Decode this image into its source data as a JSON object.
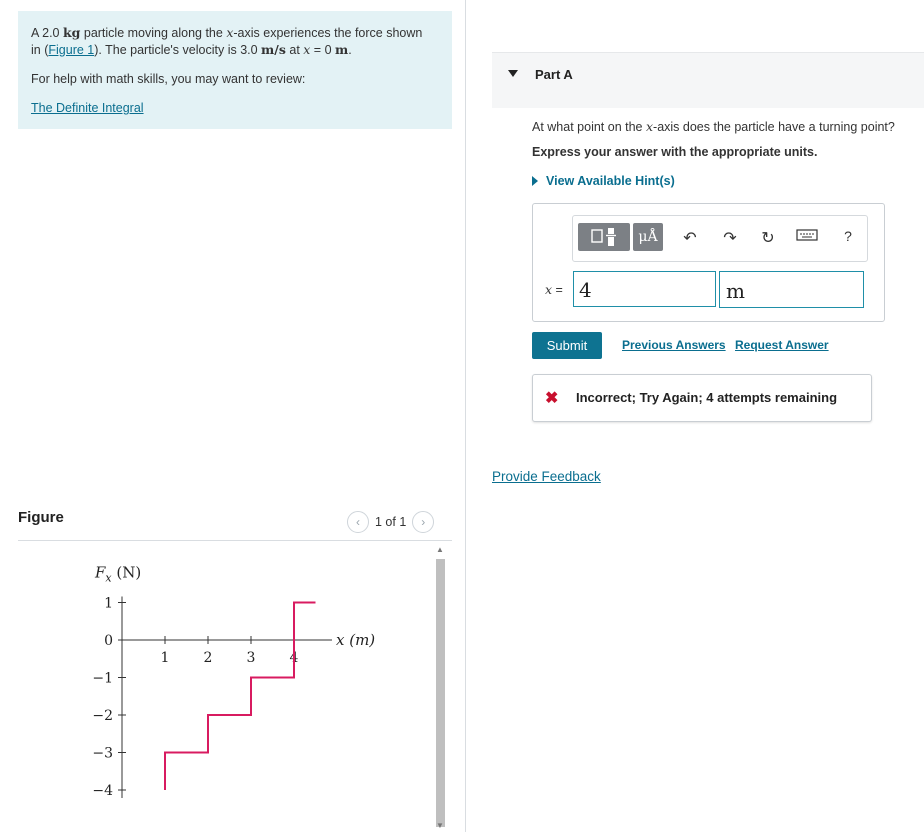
{
  "problem": {
    "line1_a": "A 2.0 ",
    "line1_kg": "kg",
    "line1_b": " particle moving along the ",
    "line1_x": "x",
    "line1_c": "-axis experiences the force shown",
    "line2_a": "in (",
    "figure_link": "Figure 1",
    "line2_b": "). The particle's velocity is 3.0 ",
    "line2_unit": "m/s",
    "line2_c": " at ",
    "line2_x": "x",
    "line2_d": " = 0 ",
    "line2_m": "m",
    "line2_e": ".",
    "help_text": "For help with math skills, you may want to review:",
    "help_link": "The Definite Integral"
  },
  "figure": {
    "title": "Figure",
    "pager_text": "1 of 1",
    "prev_icon": "chevron-left-icon",
    "next_icon": "chevron-right-icon"
  },
  "chart_data": {
    "type": "line",
    "ylabel_main": "F",
    "ylabel_sub": "x",
    "ylabel_unit": " (N)",
    "xlabel": "x (m)",
    "x_ticks": [
      "1",
      "2",
      "3",
      "4"
    ],
    "y_ticks": [
      "1",
      "0",
      "−1",
      "−2",
      "−3",
      "−4"
    ],
    "xlim": [
      0,
      5
    ],
    "ylim": [
      -4,
      1
    ],
    "series": [
      {
        "x": [
          1,
          1,
          2,
          2,
          3,
          3,
          4,
          4,
          4.5
        ],
        "y": [
          -4,
          -3,
          -3,
          -2,
          -2,
          -1,
          -1,
          1,
          1
        ],
        "color": "#d81b60"
      }
    ]
  },
  "part_a": {
    "title": "Part A",
    "question_a": "At what point on the ",
    "question_x": "x",
    "question_b": "-axis does the particle have a turning point?",
    "instruction": "Express your answer with the appropriate units.",
    "hint_label": "View Available Hint(s)",
    "toolbar": {
      "mu_label": "μÅ",
      "help_label": "?",
      "icons": [
        "templates-icon",
        "units-icon",
        "undo-icon",
        "redo-icon",
        "reset-icon",
        "keyboard-icon",
        "help-icon"
      ]
    },
    "eq_label_x": "x",
    "eq_label_eq": " =",
    "answer_value": "4",
    "answer_unit": "m",
    "submit_label": "Submit",
    "previous_answers_label": "Previous Answers",
    "request_answer_label": "Request Answer",
    "feedback_text": "Incorrect; Try Again; 4 attempts remaining",
    "feedback_color": "#c8102e"
  },
  "provide_feedback_label": "Provide Feedback"
}
